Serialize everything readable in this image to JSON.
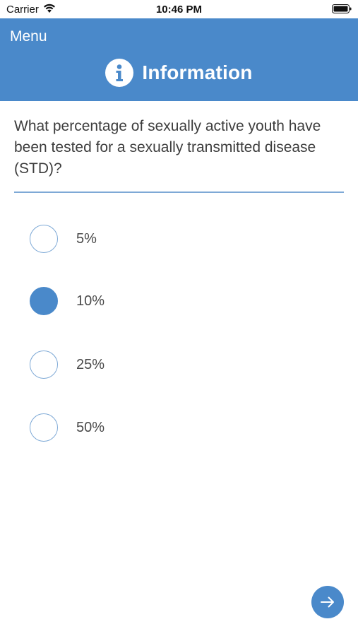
{
  "status_bar": {
    "carrier": "Carrier",
    "time": "10:46 PM",
    "wifi_icon": "wifi-icon",
    "battery_icon": "battery-icon"
  },
  "header": {
    "menu_label": "Menu",
    "title": "Information",
    "icon": "info-icon",
    "background_color": "#4a89ca"
  },
  "question": {
    "text": "What percentage of sexually active youth have been tested for a sexually transmitted disease (STD)?"
  },
  "options": [
    {
      "label": "5%",
      "selected": false
    },
    {
      "label": "10%",
      "selected": true
    },
    {
      "label": "25%",
      "selected": false
    },
    {
      "label": "50%",
      "selected": false
    }
  ],
  "next_button": {
    "icon": "arrow-right-icon"
  },
  "colors": {
    "accent": "#4a89ca",
    "divider": "#7ea9d6"
  }
}
